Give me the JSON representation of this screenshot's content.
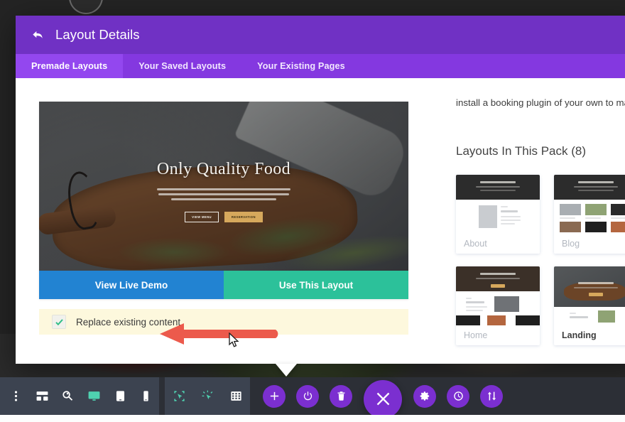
{
  "modal": {
    "title": "Layout Details",
    "back_icon": "back-arrow-icon",
    "tabs": [
      {
        "label": "Premade Layouts",
        "active": true
      },
      {
        "label": "Your Saved Layouts",
        "active": false
      },
      {
        "label": "Your Existing Pages",
        "active": false
      }
    ]
  },
  "preview": {
    "hero_title": "Only Quality Food",
    "hero_button_primary": "VIEW MENU",
    "hero_button_secondary": "RESERVATION",
    "view_demo_label": "View Live Demo",
    "use_layout_label": "Use This Layout",
    "view_demo_color": "#2283d2",
    "use_layout_color": "#2cc19a"
  },
  "replace": {
    "label": "Replace existing content",
    "checked": true,
    "check_icon": "checkmark-icon",
    "highlight_color": "#fdf8dd",
    "check_color": "#2ebd86"
  },
  "pack": {
    "description": "install a booking plugin of your own to mak",
    "heading": "Layouts In This Pack (8)",
    "layouts": [
      {
        "name": "About",
        "active": false
      },
      {
        "name": "Blog",
        "active": false
      },
      {
        "name": "Home",
        "active": false
      },
      {
        "name": "Landing",
        "active": true
      }
    ]
  },
  "annotation": {
    "arrow_color": "#ec5a4c",
    "arrow_icon": "left-arrow-annotation",
    "cursor_icon": "mouse-pointer-icon"
  },
  "builder_toolbar": {
    "left_tools": [
      {
        "name": "more-options-icon",
        "label": "More Options",
        "active": false
      },
      {
        "name": "wireframe-icon",
        "label": "Wireframe View",
        "active": false
      },
      {
        "name": "zoom-icon",
        "label": "Zoom Out",
        "active": false
      },
      {
        "name": "desktop-icon",
        "label": "Desktop View",
        "active": true
      },
      {
        "name": "tablet-icon",
        "label": "Tablet View",
        "active": false
      },
      {
        "name": "phone-icon",
        "label": "Phone View",
        "active": false
      }
    ],
    "mode_tools": [
      {
        "name": "select-mode-icon",
        "label": "Hover Mode",
        "active": true
      },
      {
        "name": "click-mode-icon",
        "label": "Click Mode",
        "active": true
      },
      {
        "name": "grid-mode-icon",
        "label": "Grid Mode",
        "active": false
      }
    ],
    "round_tools": [
      {
        "name": "add-icon",
        "label": "Add New Section",
        "big": false
      },
      {
        "name": "power-icon",
        "label": "Toggle Builder",
        "big": false
      },
      {
        "name": "trash-icon",
        "label": "Clear Layout",
        "big": false
      },
      {
        "name": "close-icon",
        "label": "Close Menu",
        "big": true
      },
      {
        "name": "gear-icon",
        "label": "Page Settings",
        "big": false
      },
      {
        "name": "history-icon",
        "label": "Editing History",
        "big": false
      },
      {
        "name": "sort-icon",
        "label": "Portability",
        "big": false
      }
    ],
    "accent_color": "#7b2fd0",
    "active_color": "#4fd1b0"
  }
}
